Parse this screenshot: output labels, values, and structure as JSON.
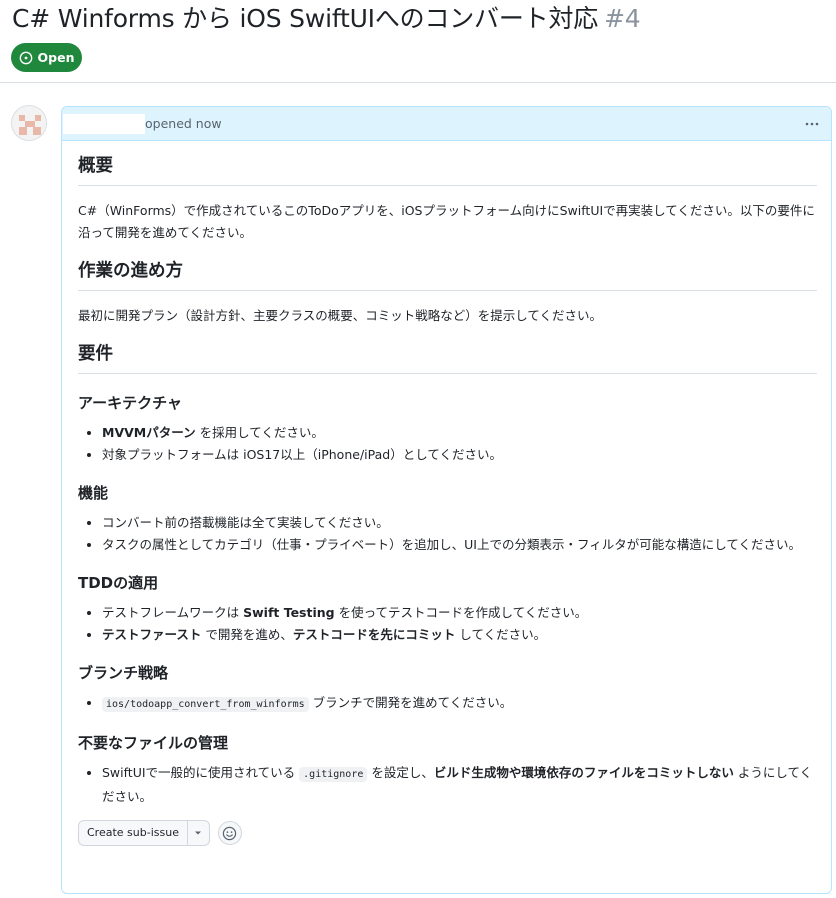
{
  "issue": {
    "title": "C# Winforms から iOS SwiftUIへのコンバート対応",
    "number": "#4",
    "state": "Open"
  },
  "comment": {
    "opened_text": "opened now",
    "heading_overview": "概要",
    "overview_text": "C#（WinForms）で作成されているこのToDoアプリを、iOSプラットフォーム向けにSwiftUIで再実装してください。以下の要件に沿って開発を進めてください。",
    "heading_process": "作業の進め方",
    "process_text": "最初に開発プラン（設計方針、主要クラスの概要、コミット戦略など）を提示してください。",
    "heading_requirements": "要件",
    "heading_arch": "アーキテクチャ",
    "arch_1_strong": "MVVMパターン",
    "arch_1_rest": " を採用してください。",
    "arch_2": "対象プラットフォームは iOS17以上（iPhone/iPad）としてください。",
    "heading_features": "機能",
    "feat_1": "コンバート前の搭載機能は全て実装してください。",
    "feat_2": "タスクの属性としてカテゴリ（仕事・プライベート）を追加し、UI上での分類表示・フィルタが可能な構造にしてください。",
    "heading_tdd": "TDDの適用",
    "tdd_1_pre": "テストフレームワークは ",
    "tdd_1_strong": "Swift Testing",
    "tdd_1_post": " を使ってテストコードを作成してください。",
    "tdd_2_strong1": "テストファースト",
    "tdd_2_mid": " で開発を進め、",
    "tdd_2_strong2": "テストコードを先にコミット",
    "tdd_2_post": " してください。",
    "heading_branch": "ブランチ戦略",
    "branch_code": "ios/todoapp_convert_from_winforms",
    "branch_rest": " ブランチで開発を進めてください。",
    "heading_files": "不要なファイルの管理",
    "files_pre": "SwiftUIで一般的に使用されている ",
    "files_code": ".gitignore",
    "files_mid": " を設定し、",
    "files_strong": "ビルド生成物や環境依存のファイルをコミットしない",
    "files_post": " ようにしてください。"
  },
  "actions": {
    "create_sub_issue": "Create sub-issue"
  },
  "colors": {
    "open_green": "#1f883d",
    "header_blue": "#ddf4ff",
    "border_blue": "#b6e3ff"
  },
  "icons": {
    "state": "issue-opened-icon",
    "menu": "kebab-horizontal-icon",
    "dropdown": "triangle-down-icon",
    "reaction": "smiley-icon"
  }
}
